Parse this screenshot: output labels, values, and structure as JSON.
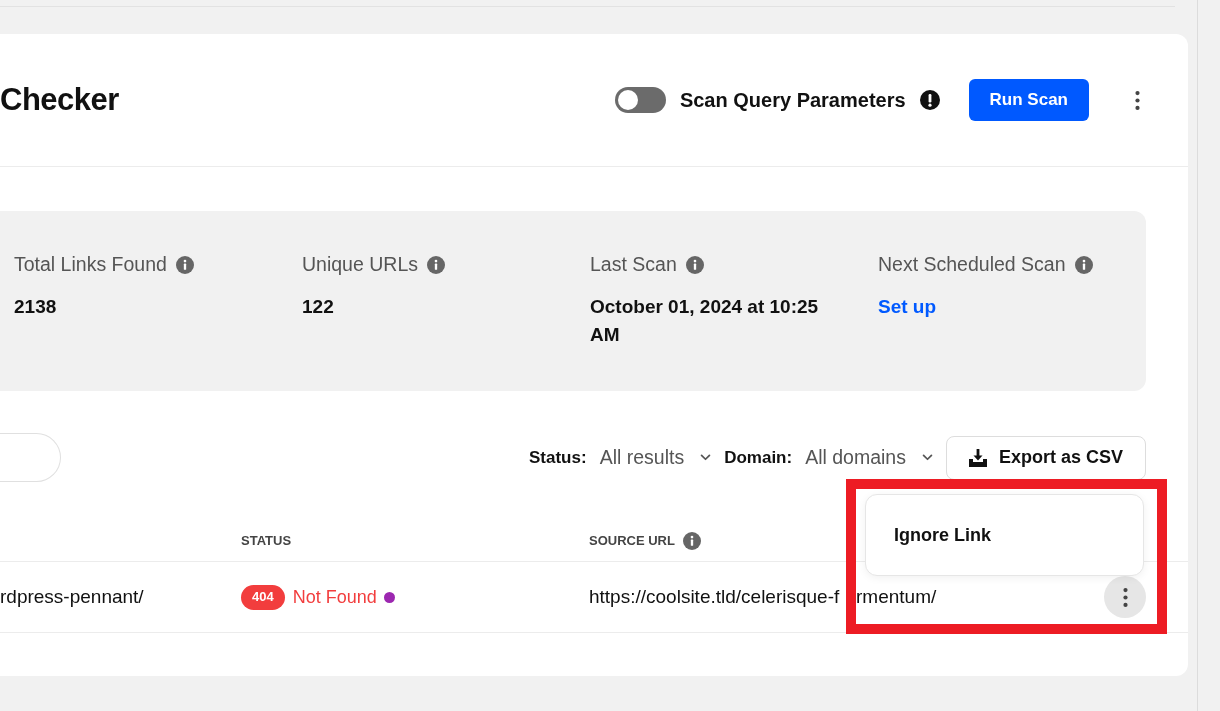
{
  "header": {
    "title": "Checker",
    "scan_query_parameters": {
      "label": "Scan Query Parameters",
      "on": false
    },
    "run_scan_button": "Run Scan"
  },
  "stats": [
    {
      "label": "Total Links Found",
      "value": "2138",
      "kind": "text"
    },
    {
      "label": "Unique URLs",
      "value": "122",
      "kind": "text"
    },
    {
      "label": "Last Scan",
      "value": "October 01, 2024 at 10:25 AM",
      "kind": "text"
    },
    {
      "label": "Next Scheduled Scan",
      "value": "Set up",
      "kind": "link"
    }
  ],
  "filters": [
    {
      "label": "Status:",
      "value": "All results"
    },
    {
      "label": "Domain:",
      "value": "All domains"
    }
  ],
  "export_button": "Export as CSV",
  "table": {
    "columns": [
      {
        "label": "STATUS",
        "info": false
      },
      {
        "label": "SOURCE URL",
        "info": true
      }
    ],
    "rows": [
      {
        "column_1": "rdpress-pennant/",
        "status_code": "404",
        "status_text": "Not Found",
        "color": "#9c27b0",
        "source_url_visible_parts": [
          "https://coolsite.tld/celerisque-f",
          "rmentum/"
        ]
      }
    ]
  },
  "row_menu": [
    "Ignore Link"
  ]
}
